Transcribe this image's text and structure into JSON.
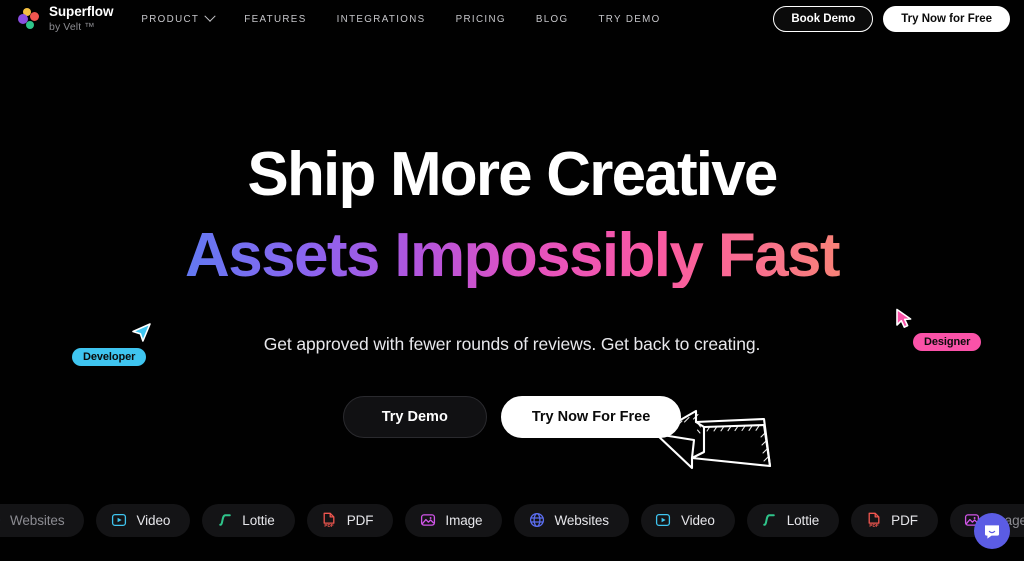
{
  "nav": {
    "brand_name": "Superflow",
    "brand_sub": "by Velt ™",
    "logo_icon": "superflow-logo-dots",
    "links": [
      {
        "label": "PRODUCT",
        "has_caret": true
      },
      {
        "label": "FEATURES",
        "has_caret": false
      },
      {
        "label": "INTEGRATIONS",
        "has_caret": false
      },
      {
        "label": "PRICING",
        "has_caret": false
      },
      {
        "label": "BLOG",
        "has_caret": false
      },
      {
        "label": "TRY DEMO",
        "has_caret": false
      }
    ],
    "book_demo_label": "Book Demo",
    "try_free_label": "Try Now for Free"
  },
  "hero": {
    "headline_line1": "Ship More Creative",
    "headline_line2": "Assets Impossibly Fast",
    "subheadline": "Get approved with fewer rounds of reviews. Get back to creating.",
    "cta_primary": "Try Demo",
    "cta_secondary": "Try Now For Free",
    "gradient_start": "#2f86f5",
    "gradient_mid": "#e452bf",
    "gradient_end": "#f7a356"
  },
  "cursors": [
    {
      "label": "Developer",
      "color": "#3fc5f0",
      "icon": "cursor-pointer-icon"
    },
    {
      "label": "Designer",
      "color": "#fa52a8",
      "icon": "cursor-arrow-icon"
    }
  ],
  "chips": [
    {
      "label": "Websites",
      "icon": "globe-icon",
      "color": "#5b6ef0",
      "dim": true
    },
    {
      "label": "Video",
      "icon": "video-icon",
      "color": "#3fc5f0",
      "dim": false
    },
    {
      "label": "Lottie",
      "icon": "lottie-icon",
      "color": "#2fc48a",
      "dim": false
    },
    {
      "label": "PDF",
      "icon": "pdf-icon",
      "color": "#f0564f",
      "dim": false
    },
    {
      "label": "Image",
      "icon": "image-icon",
      "color": "#d155e8",
      "dim": false
    },
    {
      "label": "Websites",
      "icon": "globe-icon",
      "color": "#5b6ef0",
      "dim": false
    },
    {
      "label": "Video",
      "icon": "video-icon",
      "color": "#3fc5f0",
      "dim": false
    },
    {
      "label": "Lottie",
      "icon": "lottie-icon",
      "color": "#2fc48a",
      "dim": false
    },
    {
      "label": "PDF",
      "icon": "pdf-icon",
      "color": "#f0564f",
      "dim": false
    },
    {
      "label": "Image",
      "icon": "image-icon",
      "color": "#d155e8",
      "dim": true
    }
  ],
  "widgets": {
    "chat_icon": "intercom-chat-icon",
    "chat_color": "#5b5ce4",
    "arrow_icon": "sketch-arrow-left-icon"
  }
}
